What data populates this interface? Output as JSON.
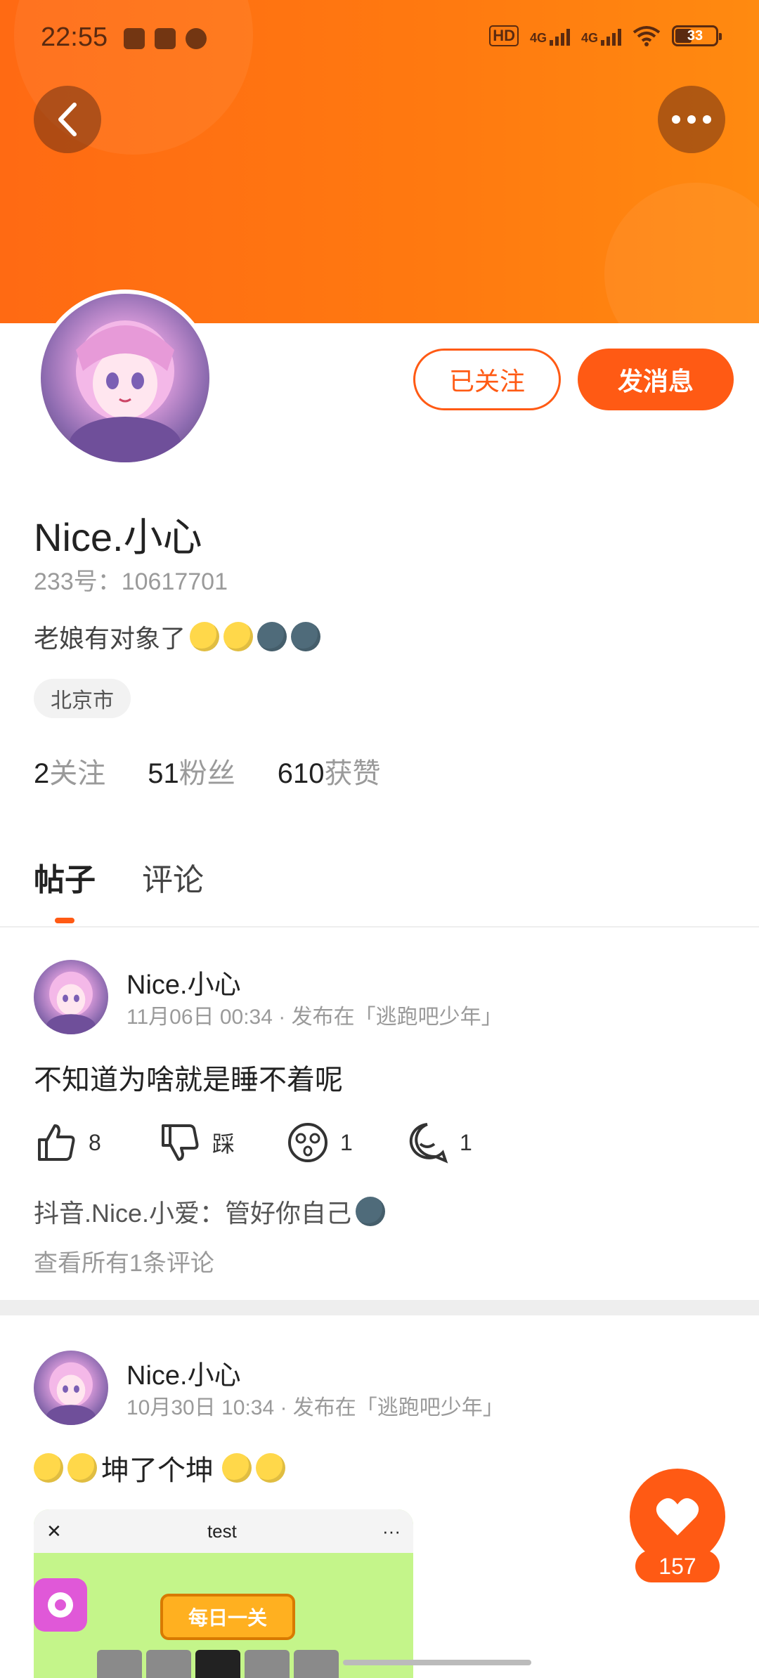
{
  "status_bar": {
    "time": "22:55",
    "hd_label": "HD",
    "network_1": "4G",
    "network_2": "4G",
    "battery": "33"
  },
  "header": {
    "back_icon": "chevron-left-icon",
    "more_icon": "more-dots-icon",
    "color": "#ff6a13"
  },
  "profile": {
    "name": "Nice.小心",
    "id_text": "233号：10617701",
    "bio": "老娘有对象了",
    "bio_emojis": [
      "yellow-moon-face",
      "yellow-moon-face",
      "dark-moon-face",
      "dark-moon-face"
    ],
    "location": "北京市",
    "followed_label": "已关注",
    "message_label": "发消息",
    "stats": [
      {
        "num": "2",
        "label": "关注"
      },
      {
        "num": "51",
        "label": "粉丝"
      },
      {
        "num": "610",
        "label": "获赞"
      }
    ]
  },
  "tabs": [
    {
      "label": "帖子",
      "active": true
    },
    {
      "label": "评论",
      "active": false
    }
  ],
  "posts": [
    {
      "author": "Nice.小心",
      "meta": "11月06日 00:34 · 发布在「逃跑吧少年」",
      "text": "不知道为啥就是睡不着呢",
      "actions": {
        "like": "8",
        "dislike": "踩",
        "wow": "1",
        "comment": "1"
      },
      "comment_preview": "抖音.Nice.小爱：管好你自己",
      "view_all": "查看所有1条评论"
    },
    {
      "author": "Nice.小心",
      "meta": "10月30日 10:34 · 发布在「逃跑吧少年」",
      "text": "坤了个坤",
      "game": {
        "title": "test",
        "close": "✕",
        "more": "···",
        "banner": "每日一关"
      }
    }
  ],
  "fab": {
    "like_count": "157",
    "icon": "heart-icon"
  },
  "colors": {
    "accent": "#ff5a14",
    "header": "#ff6a13"
  }
}
